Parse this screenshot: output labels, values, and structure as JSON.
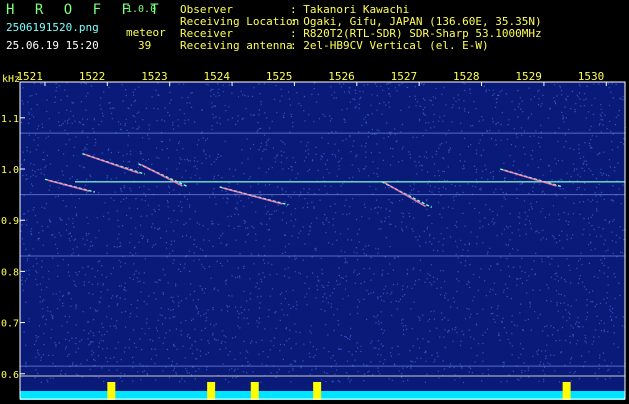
{
  "header": {
    "app_name": "H R O F F T",
    "version": "1.0.0",
    "filename": "2506191520.png",
    "datetime": "25.06.19 15:20",
    "meteor_label": "meteor",
    "meteor_count": "39",
    "info": [
      {
        "key": "Observer",
        "value": ": Takanori Kawachi"
      },
      {
        "key": "Receiving Location",
        "value": ": Ogaki, Gifu, JAPAN (136.60E, 35.35N)"
      },
      {
        "key": "Receiver",
        "value": ": R820T2(RTL-SDR) SDR-Sharp 53.1000MHz"
      },
      {
        "key": "Receiving antenna",
        "value": ": 2el-HB9CV Vertical (el. E-W)"
      }
    ]
  },
  "chart_data": {
    "type": "heatmap",
    "ylabel": "kHz",
    "x_ticks": [
      "1521",
      "1522",
      "1523",
      "1524",
      "1525",
      "1526",
      "1527",
      "1528",
      "1529",
      "1530"
    ],
    "y_ticks": [
      "1.1",
      "1.0",
      "0.9",
      "0.8",
      "0.7",
      "0.6"
    ],
    "ylim": [
      0.58,
      1.17
    ],
    "carrier_khz": 0.975,
    "steady_lines_khz": [
      1.07,
      0.95,
      0.83,
      0.615
    ],
    "meteor_traces": [
      {
        "x0": 1521.0,
        "y0": 0.98,
        "x1": 1521.8,
        "y1": 0.955
      },
      {
        "x0": 1521.6,
        "y0": 1.03,
        "x1": 1522.6,
        "y1": 0.99
      },
      {
        "x0": 1522.5,
        "y0": 1.01,
        "x1": 1523.3,
        "y1": 0.965
      },
      {
        "x0": 1523.8,
        "y0": 0.965,
        "x1": 1524.9,
        "y1": 0.93
      },
      {
        "x0": 1526.4,
        "y0": 0.975,
        "x1": 1527.2,
        "y1": 0.925
      },
      {
        "x0": 1528.3,
        "y0": 1.0,
        "x1": 1529.3,
        "y1": 0.965
      }
    ],
    "colors": {
      "background": "#0a1a78",
      "noise": "#3f67e0",
      "carrier": "#7fffd0",
      "trace": "#ff8fbf",
      "baseline_fill": "#00e5ff",
      "baseline_peak": "#ffff00",
      "tick_label": "#ffff55"
    }
  }
}
